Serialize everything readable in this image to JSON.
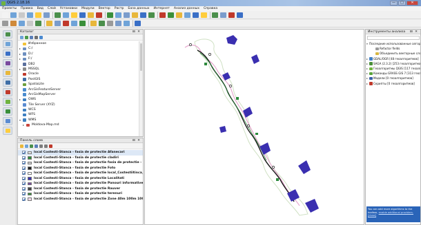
{
  "window": {
    "title": "QGIS 2.18.16",
    "min": "—",
    "max": "□",
    "close": "✕"
  },
  "menu": [
    "Проекты",
    "Правка",
    "Вид",
    "Слой",
    "Установки",
    "Модули",
    "Вектор",
    "Растр",
    "База данных",
    "Интернет",
    "Анализ данных",
    "Справка"
  ],
  "colors": {
    "accent": "#3a6fc6",
    "route": "#e6a8cf",
    "river": "#1a1a1a",
    "area": "#3a2fb0",
    "green": "#2c8a3c"
  },
  "browser": {
    "title": "Каталог",
    "controls": "⊟ ✕",
    "items": [
      {
        "label": "Избранное",
        "arrow": "",
        "icon": "star-icon",
        "color": "#f2c237"
      },
      {
        "label": "C:/",
        "arrow": "▸",
        "icon": "drive-icon",
        "color": "#6d8fbf"
      },
      {
        "label": "D:/",
        "arrow": "▸",
        "icon": "drive-icon",
        "color": "#6d8fbf"
      },
      {
        "label": "F:/",
        "arrow": "▸",
        "icon": "drive-icon",
        "color": "#6d8fbf"
      },
      {
        "label": "DB2",
        "arrow": "",
        "icon": "database-icon",
        "color": "#5a6f9e"
      },
      {
        "label": "MSSQL",
        "arrow": "▸",
        "icon": "database-icon",
        "color": "#8b8b8b"
      },
      {
        "label": "Oracle",
        "arrow": "",
        "icon": "database-icon",
        "color": "#c0392b"
      },
      {
        "label": "PostGIS",
        "arrow": "",
        "icon": "elephant-icon",
        "color": "#3f6ea6"
      },
      {
        "label": "SpatiaLite",
        "arrow": "",
        "icon": "feather-icon",
        "color": "#6c9f3c"
      },
      {
        "label": "ArcGisFeatureServer",
        "arrow": "",
        "icon": "globe-icon",
        "color": "#4a8ccf"
      },
      {
        "label": "ArcGisMapServer",
        "arrow": "",
        "icon": "globe-icon",
        "color": "#4a8ccf"
      },
      {
        "label": "OWS",
        "arrow": "▸",
        "icon": "globe-icon",
        "color": "#3d7fc1"
      },
      {
        "label": "Tile Server (XYZ)",
        "arrow": "",
        "icon": "grid-icon",
        "color": "#5a8bd1"
      },
      {
        "label": "WCS",
        "arrow": "",
        "icon": "globe-icon",
        "color": "#3d7fc1"
      },
      {
        "label": "WFS",
        "arrow": "",
        "icon": "globe-icon",
        "color": "#3d7fc1"
      },
      {
        "label": "WMS",
        "arrow": "▾",
        "icon": "globe-icon",
        "color": "#3d7fc1"
      },
      {
        "label": "Moldova-Map.md",
        "arrow": "▸",
        "icon": "map-icon",
        "color": "#c9463d",
        "indent": true
      }
    ]
  },
  "layers_panel": {
    "title": "Панель слоев",
    "controls": "⊟ ✕",
    "items": [
      {
        "label": "local Costesti-Stanca - fasia de protectie Afanecari",
        "sym": "#e8e8e8",
        "selected": true
      },
      {
        "label": "local Costesti-Stanca - fasia de protectie cladiri",
        "sym": "#2e8b3a"
      },
      {
        "label": "local Costesti-Stanca - fasia de protectie fasia de protectie - masuri",
        "sym": "#cfcfcf"
      },
      {
        "label": "local Costesti-Stanca - fasia de protectie Foto",
        "sym": "#222222"
      },
      {
        "label": "local Costesti-Stanca - fasia de protectie local_Costestiitinca_delimitat",
        "sym": "#ffffff"
      },
      {
        "label": "local Costesti-Stanca - fasia de protectie Localitati",
        "sym": "#3a2fb0"
      },
      {
        "label": "local Costesti-Stanca - fasia de protectie Panouri informative",
        "sym": "#7a4a9e"
      },
      {
        "label": "local Costesti-Stanca - fasia de protectie Rauver",
        "sym": "#444444"
      },
      {
        "label": "local Costesti-Stanca - fasia de protectie terenuri",
        "sym": "#3a8f3a"
      },
      {
        "label": "local Costesti-Stanca - fasia de protectie Zone 40m 100m 1000m",
        "sym": "#f2d6e8"
      }
    ]
  },
  "toolbox": {
    "title": "Инструменты анализа",
    "controls": "⊟ ✕",
    "items": [
      {
        "label": "Последние использованные алгоритмы",
        "arrow": "▾",
        "icon": "",
        "color": "#ffffff",
        "level": 0
      },
      {
        "label": "Refactor fields",
        "arrow": "",
        "icon": "tool-icon",
        "color": "#9a9a9a",
        "level": 1
      },
      {
        "label": "Объединить векторные слои",
        "arrow": "",
        "icon": "tool-icon",
        "color": "#d8b640",
        "level": 1
      },
      {
        "label": "GDAL/OGR [48 геоалгоритмов]",
        "arrow": "▸",
        "icon": "gdal-icon",
        "color": "#3f7ec6",
        "level": 0
      },
      {
        "label": "SAGA (2.3.2) [253 геоалгоритма]",
        "arrow": "▸",
        "icon": "saga-icon",
        "color": "#4a8f3a",
        "level": 0
      },
      {
        "label": "Геоалгоритмы QGIS [117 геоалг...",
        "arrow": "▸",
        "icon": "qgis-icon",
        "color": "#6fb33f",
        "level": 0
      },
      {
        "label": "Команды GRASS GIS 7 [313 геоа...",
        "arrow": "▸",
        "icon": "grass-icon",
        "color": "#5aa33a",
        "level": 0
      },
      {
        "label": "Модели [0 геоалгоритмов]",
        "arrow": "▸",
        "icon": "model-icon",
        "color": "#3a5fa8",
        "level": 0
      },
      {
        "label": "Скрипты [0 геоалгоритмов]",
        "arrow": "▸",
        "icon": "script-icon",
        "color": "#c0392b",
        "level": 0
      }
    ],
    "hint_text": "You can add more algorithms to the toolbox,",
    "hint_link1": "enable additional providers.",
    "hint_link2": "[close]"
  }
}
